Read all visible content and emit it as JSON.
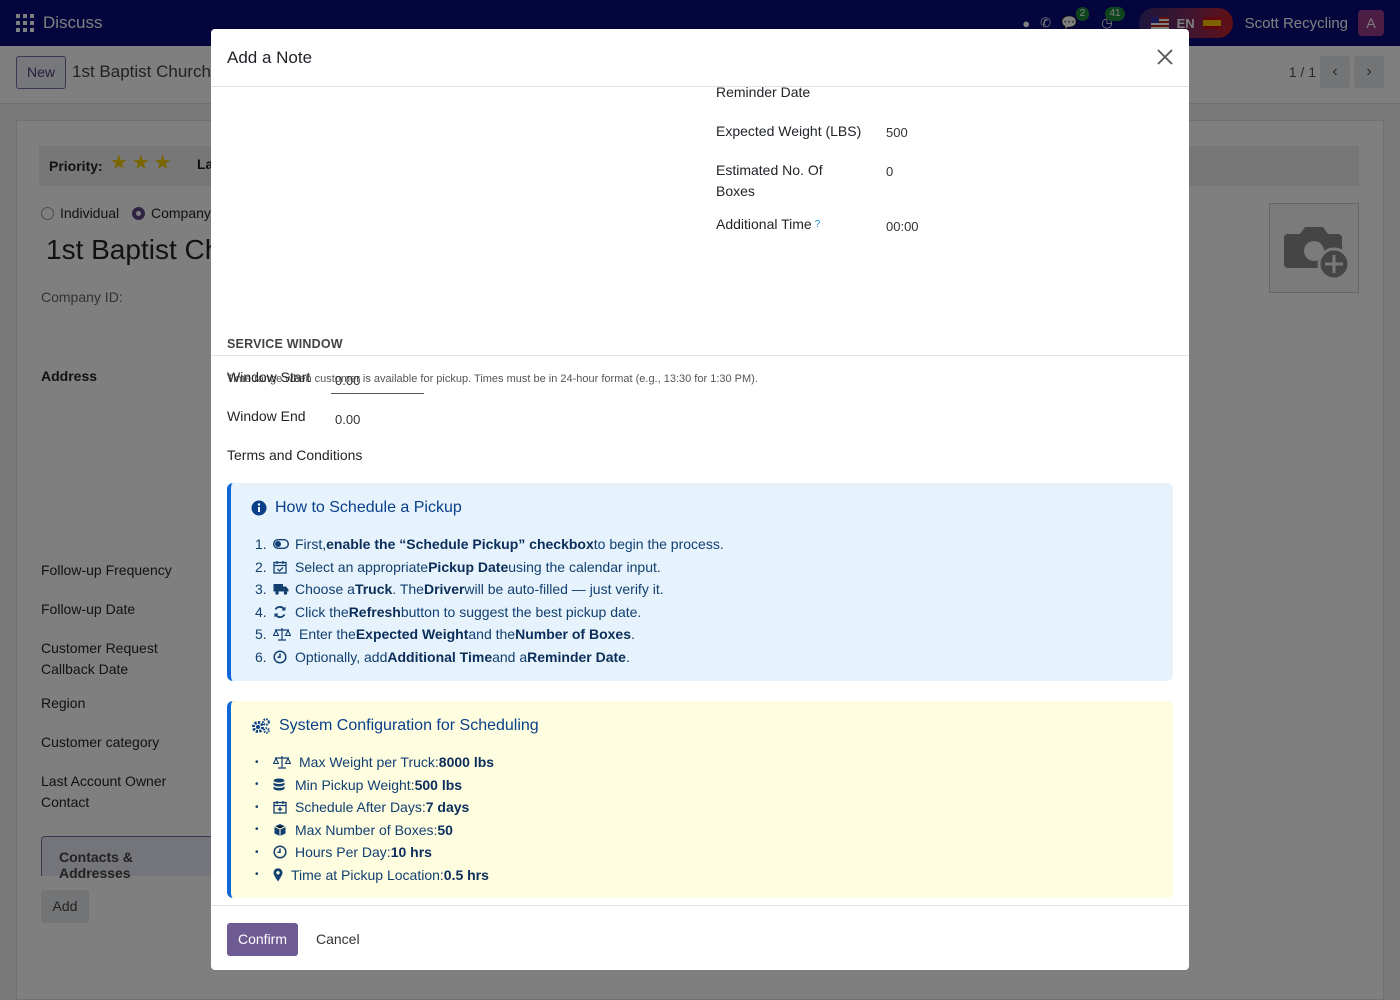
{
  "navbar": {
    "app_name": "Discuss",
    "chat_count": "2",
    "activity_count": "41",
    "lang": "EN",
    "company": "Scott Recycling",
    "avatar_letter": "A"
  },
  "control_panel": {
    "new_label": "New",
    "breadcrumb": "1st Baptist Church",
    "pager": "1 / 1"
  },
  "background_form": {
    "priority_label": "Priority:",
    "priority_stars": 3,
    "partial_label": "La",
    "type_individual": "Individual",
    "type_company": "Company",
    "name_partial": "1st Baptist Ch",
    "company_id_label": "Company ID:",
    "address_label": "Address",
    "followup_frequency": "Follow-up Frequency",
    "followup_date": "Follow-up Date",
    "callback_date_1": "Customer Request",
    "callback_date_2": "Callback Date",
    "region": "Region",
    "customer_category": "Customer category",
    "last_owner_1": "Last Account Owner",
    "last_owner_2": "Contact",
    "tab_contacts": "Contacts & Addresses",
    "add_label": "Add"
  },
  "modal": {
    "title": "Add a Note",
    "fields": {
      "reminder_date_label": "Reminder Date",
      "expected_weight_label": "Expected Weight (LBS)",
      "expected_weight_value": "500",
      "boxes_label_1": "Estimated No. Of",
      "boxes_label_2": "Boxes",
      "boxes_value": "0",
      "additional_time_label": "Additional Time",
      "additional_time_help": "?",
      "additional_time_value": "00:00"
    },
    "service_window": {
      "title": "SERVICE WINDOW",
      "note": "Time range when customer is available for pickup. Times must be in 24-hour format (e.g., 13:30 for 1:30 PM).",
      "window_start_label": "Window Start",
      "window_start_value": "0.00",
      "window_end_label": "Window End",
      "window_end_value": "0.00",
      "terms_label": "Terms and Conditions"
    },
    "how_to": {
      "title": "How to Schedule a Pickup",
      "steps": [
        {
          "num": "1.",
          "pre": "First, ",
          "b1": "enable the “Schedule Pickup” checkbox",
          "mid": " to begin the process.",
          "b2": "",
          "post": ""
        },
        {
          "num": "2.",
          "pre": "Select an appropriate ",
          "b1": "Pickup Date",
          "mid": " using the calendar input.",
          "b2": "",
          "post": ""
        },
        {
          "num": "3.",
          "pre": "Choose a ",
          "b1": "Truck",
          "mid": ". The ",
          "b2": "Driver",
          "post": " will be auto-filled — just verify it."
        },
        {
          "num": "4.",
          "pre": "Click the ",
          "b1": "Refresh",
          "mid": " button to suggest the best pickup date.",
          "b2": "",
          "post": ""
        },
        {
          "num": "5.",
          "pre": "Enter the ",
          "b1": "Expected Weight",
          "mid": " and the ",
          "b2": "Number of Boxes",
          "post": "."
        },
        {
          "num": "6.",
          "pre": "Optionally, add ",
          "b1": "Additional Time",
          "mid": " and a ",
          "b2": "Reminder Date",
          "post": "."
        }
      ]
    },
    "config": {
      "title": "System Configuration for Scheduling",
      "items": [
        {
          "label": "Max Weight per Truck: ",
          "value": "8000 lbs",
          "icon": "balance-scale-icon"
        },
        {
          "label": "Min Pickup Weight: ",
          "value": "500 lbs",
          "icon": "database-icon"
        },
        {
          "label": "Schedule After Days: ",
          "value": "7 days",
          "icon": "calendar-plus-icon"
        },
        {
          "label": "Max Number of Boxes: ",
          "value": "50",
          "icon": "cube-icon"
        },
        {
          "label": "Hours Per Day: ",
          "value": "10 hrs",
          "icon": "clock-icon"
        },
        {
          "label": "Time at Pickup Location: ",
          "value": "0.5 hrs",
          "icon": "map-marker-icon"
        }
      ]
    },
    "footer": {
      "confirm_label": "Confirm",
      "cancel_label": "Cancel"
    }
  }
}
